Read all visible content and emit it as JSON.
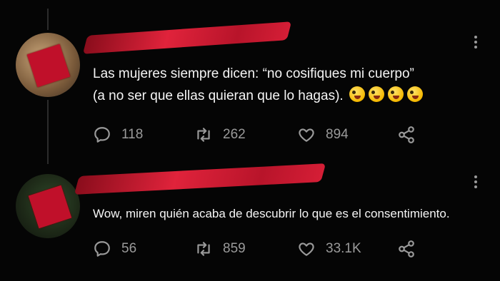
{
  "tweets": [
    {
      "text_line1": "Las mujeres siempre dicen: “no cosifiques mi cuerpo”",
      "text_line2": "(a no ser que ellas quieran que lo hagas).",
      "emoji": [
        "zany-face",
        "zany-face",
        "zany-face",
        "zany-face"
      ],
      "replies": "118",
      "retweets": "262",
      "likes": "894"
    },
    {
      "text_line1": "Wow, miren quién acaba de descubrir lo que es el consentimiento.",
      "replies": "56",
      "retweets": "859",
      "likes": "33.1K"
    }
  ],
  "icons": {
    "reply": "reply-icon",
    "retweet": "retweet-icon",
    "like": "heart-icon",
    "share": "share-icon",
    "more": "more-icon"
  },
  "colors": {
    "background": "#050505",
    "text": "#f5f5f5",
    "muted": "#9a9a9a",
    "redaction": "#d51e36"
  }
}
